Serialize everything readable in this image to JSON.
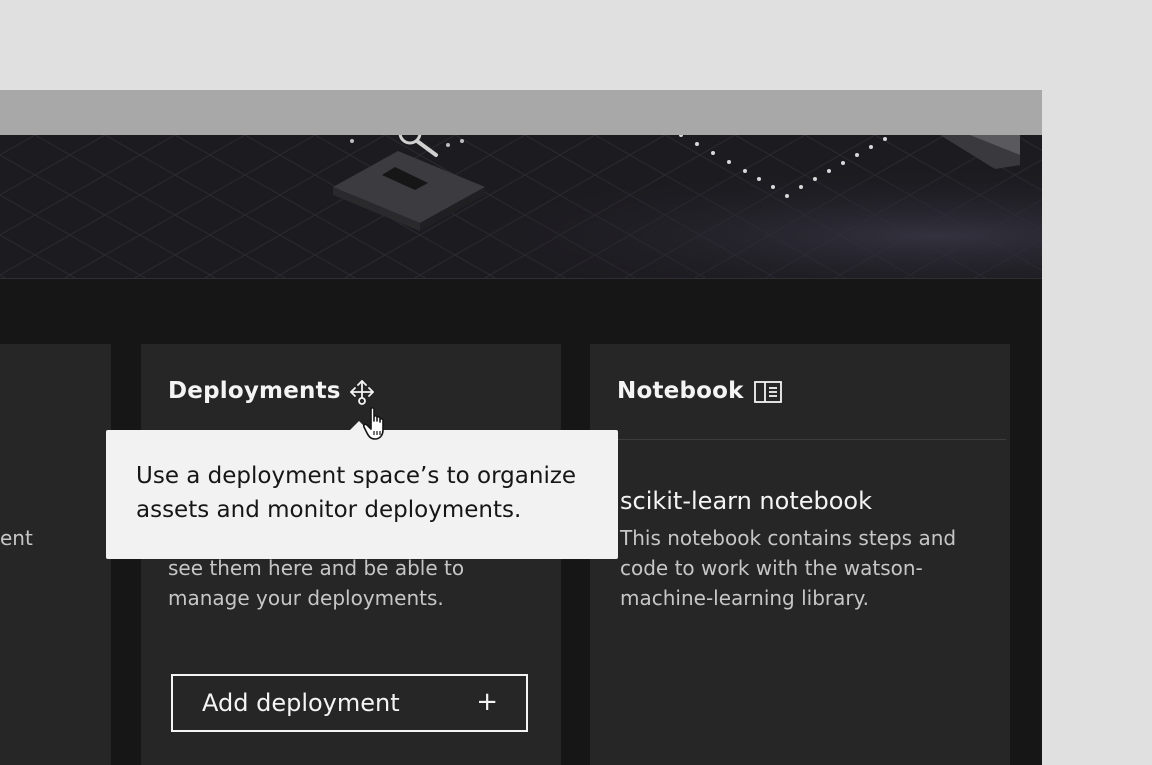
{
  "cards": {
    "left": {
      "partial_text": "ent"
    },
    "deployments": {
      "title": "Deployments",
      "icon": "move-arrows-icon",
      "body_lines": [
        "see them here and be able to",
        "manage your deployments."
      ],
      "add_button_label": "Add deployment",
      "add_button_icon": "+"
    },
    "notebook": {
      "title": "Notebook",
      "icon": "book-open-icon",
      "item_title": "scikit-learn notebook",
      "item_description_lines": [
        "This notebook contains steps and",
        "code to work with the watson-",
        "machine-learning library."
      ]
    }
  },
  "tooltip": {
    "lines": [
      "Use a deployment space’s to organize",
      "assets and monitor deployments."
    ]
  },
  "colors": {
    "page_background": "#e0e0e0",
    "titlebar": "#a8a8a8",
    "app_background": "#161616",
    "card_background": "#262626",
    "text_primary": "#f4f4f4",
    "text_secondary": "#c6c6c6",
    "tooltip_background": "#f2f2f2",
    "tooltip_text": "#161616"
  }
}
